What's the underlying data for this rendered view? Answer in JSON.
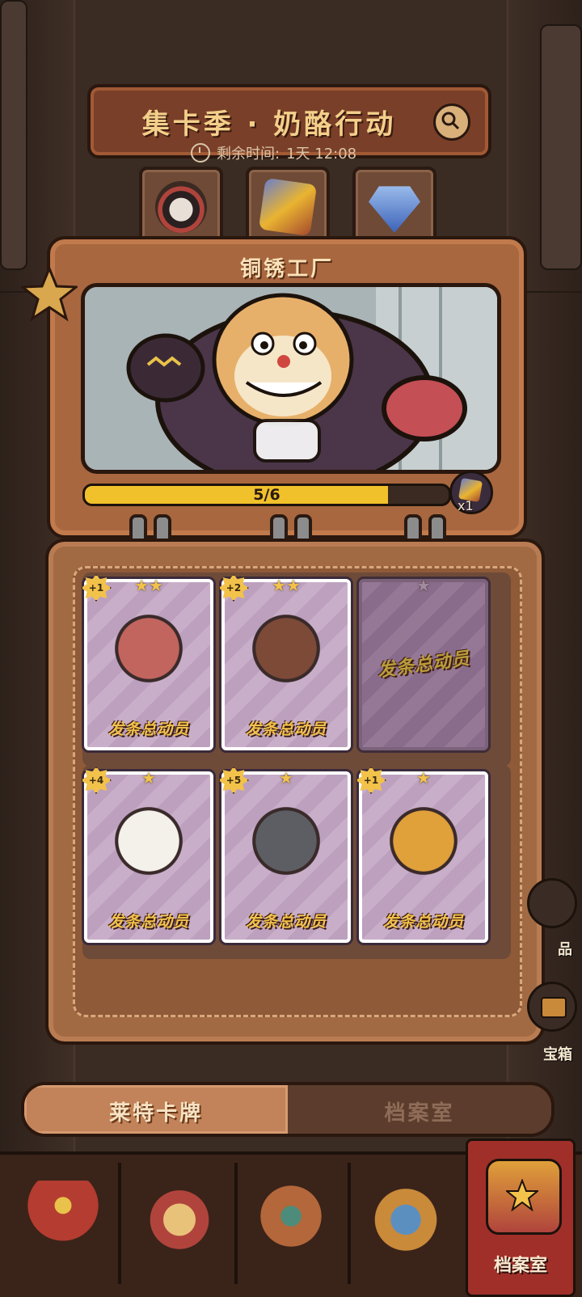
{
  "header": {
    "title": "集卡季 · 奶酪行动",
    "timer_label": "剩余时间:",
    "timer_value": "1天 12:08"
  },
  "top_tabs": [
    {
      "icon": "robot-character-icon"
    },
    {
      "icon": "magic-cube-icon"
    },
    {
      "icon": "blue-diamond-icon"
    }
  ],
  "album": {
    "title": "铜锈工厂",
    "progress_text": "5/6",
    "progress_fraction": 0.8333,
    "reward_count": "x1"
  },
  "cards": [
    {
      "badge": "+1",
      "stars": "★★",
      "logo": "发条总动员",
      "empty": false,
      "color": "#c2655e"
    },
    {
      "badge": "+2",
      "stars": "★★",
      "logo": "发条总动员",
      "empty": false,
      "color": "#7d4a38"
    },
    {
      "badge": "",
      "stars": "★",
      "logo": "发条总动员",
      "empty": true,
      "color": "#9a7ea0"
    },
    {
      "badge": "+4",
      "stars": "★",
      "logo": "发条总动员",
      "empty": false,
      "color": "#f4f0ea"
    },
    {
      "badge": "+5",
      "stars": "★",
      "logo": "发条总动员",
      "empty": false,
      "color": "#5d5e63"
    },
    {
      "badge": "+1",
      "stars": "★",
      "logo": "发条总动员",
      "empty": false,
      "color": "#e0a03a"
    }
  ],
  "side": {
    "upper_label": "品",
    "chest_label": "宝箱"
  },
  "segment": {
    "left": "莱特卡牌",
    "right": "档案室"
  },
  "nav": {
    "items": [
      {
        "icon": "mouse-star-chest-icon",
        "label": ""
      },
      {
        "icon": "treasure-bag-icon",
        "label": ""
      },
      {
        "icon": "control-panel-icon",
        "label": ""
      },
      {
        "icon": "goggle-helmet-icon",
        "label": ""
      },
      {
        "icon": "archive-book-icon",
        "label": "档案室"
      }
    ]
  },
  "colors": {
    "accent": "#f0c12b",
    "panel": "#a8673f",
    "active_tab": "#a02f2a"
  }
}
